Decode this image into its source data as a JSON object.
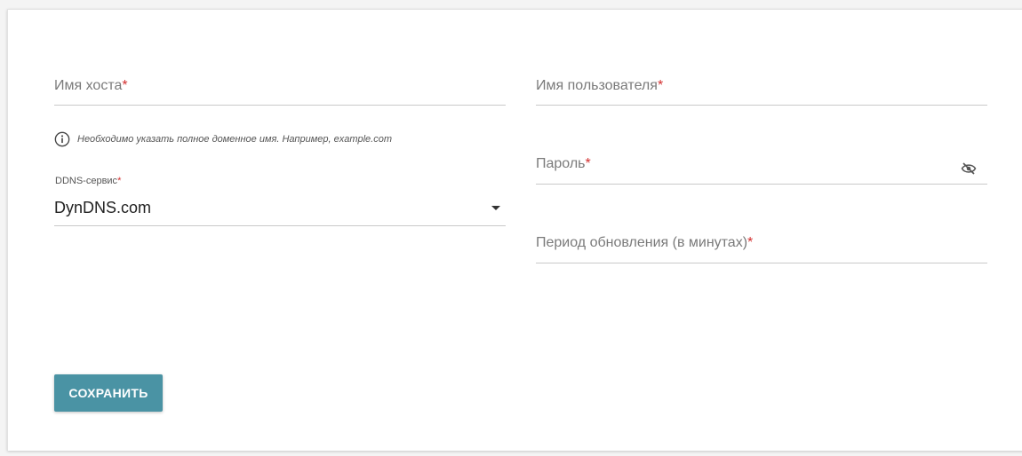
{
  "form": {
    "hostname": {
      "label": "Имя хоста",
      "required_mark": "*"
    },
    "hostname_hint": "Необходимо указать полное доменное имя. Например, example.com",
    "ddns_service": {
      "label": "DDNS-сервис",
      "required_mark": "*",
      "value": "DynDNS.com"
    },
    "username": {
      "label": "Имя пользователя",
      "required_mark": "*"
    },
    "password": {
      "label": "Пароль",
      "required_mark": "*"
    },
    "update_period": {
      "label": "Период обновления (в минутах)",
      "required_mark": "*"
    },
    "save_label": "СОХРАНИТЬ"
  },
  "icons": {
    "hint": "info-icon",
    "password_toggle": "eye-off-icon",
    "dropdown": "caret-down-icon"
  },
  "colors": {
    "accent": "#4a93a4",
    "required": "#d32f2f"
  }
}
